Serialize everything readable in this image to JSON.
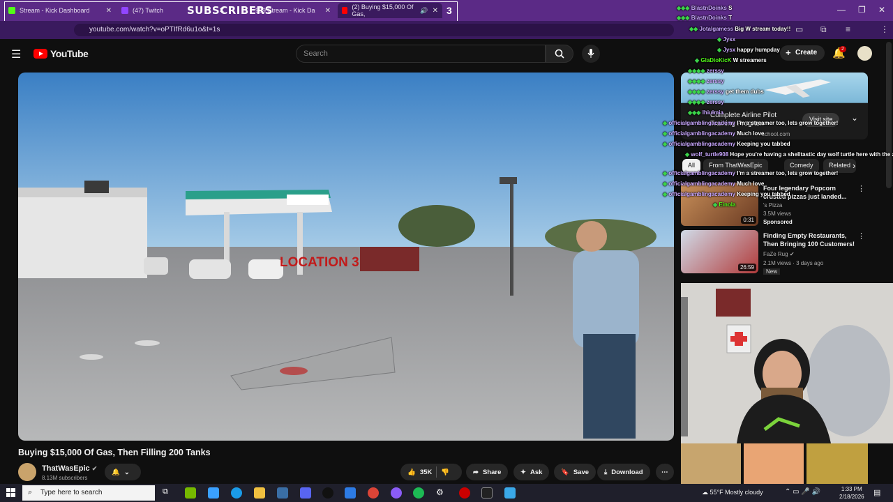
{
  "browser": {
    "tabs": [
      {
        "label": "Stream - Kick Dashboard",
        "color": "#53fc18"
      },
      {
        "label": "(47) Twitch",
        "color": "#9146ff"
      },
      {
        "label": "999 Stream - Kick Da",
        "color": "#53fc18"
      },
      {
        "label": "(2) Buying $15,000 Of Gas,",
        "color": "#ff0000"
      }
    ],
    "overlay_label": "SUBSCRIBERS",
    "overlay_count": "3",
    "url": "youtube.com/watch?v=oPTIfRd6u1o&t=1s"
  },
  "youtube": {
    "logo": "YouTube",
    "search_placeholder": "Search",
    "create_label": "Create",
    "notifications_count": "2"
  },
  "video": {
    "title": "Buying $15,000 Of Gas, Then Filling 200 Tanks",
    "overlay_text": "LOCATION 3",
    "channel": "ThatWasEpic",
    "subscribers": "8.13M subscribers",
    "likes": "35K",
    "share": "Share",
    "ask": "Ask",
    "save": "Save",
    "download": "Download"
  },
  "ad": {
    "title": "Complete Airline Pilot Training Program",
    "cta": "Visit site",
    "domain": "school.com"
  },
  "chips": [
    "All",
    "From ThatWasEpic",
    "Comedy",
    "Related"
  ],
  "recommendations": [
    {
      "title": "Four legendary Popcorn crusted pizzas just landed...",
      "channel": "'s Pizza",
      "meta": "3.5M views",
      "badge": "Sponsored",
      "duration": "0:31"
    },
    {
      "title": "Finding Empty Restaurants, Then Bringing 100 Customers!",
      "channel": "FaZe Rug",
      "meta": "2.1M views · 3 days ago",
      "badge": "New",
      "duration": "26:59"
    }
  ],
  "chat": [
    {
      "user": "BlastnDoinks",
      "msg": "S"
    },
    {
      "user": "BlastnDoinks",
      "msg": "T"
    },
    {
      "user": "Jotalgamess",
      "msg": "Big W stream today!!"
    },
    {
      "user": "Jysx",
      "msg": ""
    },
    {
      "user": "Jysx",
      "msg": "happy humpday"
    },
    {
      "user": "GlaDioKicK",
      "msg": "W streamers"
    },
    {
      "user": "zerssy",
      "msg": ""
    },
    {
      "user": "zerssy",
      "msg": ""
    },
    {
      "user": "zerssy",
      "msg": "get them dubs"
    },
    {
      "user": "zerssy",
      "msg": ""
    },
    {
      "user": "lhiulmia",
      "msg": ""
    },
    {
      "user": "officialgamblingacademy",
      "msg": "I'm a streamer too, lets grow together!"
    },
    {
      "user": "officialgamblingacademy",
      "msg": "Much love"
    },
    {
      "user": "officialgamblingacademy",
      "msg": "Keeping you tabbed"
    },
    {
      "user": "wolf_turtle908",
      "msg": "Hope you're having a shelltastic day wolf turtle here with the a"
    },
    {
      "user": "officialgamblingacademy",
      "msg": "I'm a streamer too, lets grow together!"
    },
    {
      "user": "officialgamblingacademy",
      "msg": "Much love"
    },
    {
      "user": "officialgamblingacademy",
      "msg": "Keeping you tabbed"
    },
    {
      "user": "Einola",
      "msg": ""
    }
  ],
  "taskbar": {
    "search_placeholder": "Type here to search",
    "weather": "55°F  Mostly cloudy",
    "time": "1:33 PM",
    "date": "2/18/2026"
  }
}
